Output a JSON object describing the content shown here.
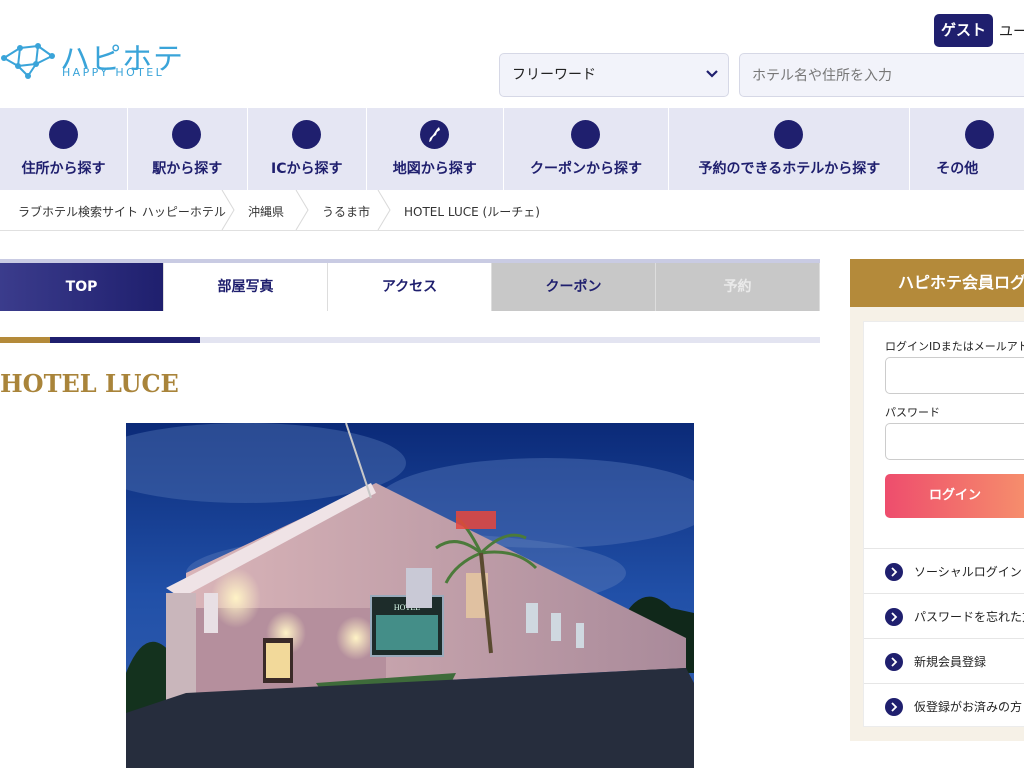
{
  "header": {
    "logo_jp": "ハピホテ",
    "logo_en": "HAPPY HOTEL",
    "guest_label": "ゲスト",
    "user_link": "ユー",
    "search_mode": "フリーワード",
    "search_placeholder": "ホテル名や住所を入力"
  },
  "nav": {
    "items": [
      {
        "label": "住所から探す",
        "icon": "area-icon"
      },
      {
        "label": "駅から探す",
        "icon": "station-icon"
      },
      {
        "label": "ICから探す",
        "icon": "highway-icon"
      },
      {
        "label": "地図から探す",
        "icon": "map-icon"
      },
      {
        "label": "クーポンから探す",
        "icon": "coupon-icon"
      },
      {
        "label": "予約のできるホテルから探す",
        "icon": "reserve-icon"
      },
      {
        "label": "その他",
        "icon": "more-icon"
      }
    ]
  },
  "breadcrumb": [
    "ラブホテル検索サイト ハッピーホテル",
    "沖縄県",
    "うるま市",
    "HOTEL LUCE (ルーチェ)"
  ],
  "tabs": [
    "TOP",
    "部屋写真",
    "アクセス",
    "クーポン",
    "予約"
  ],
  "hotel": {
    "name": "HOTEL LUCE",
    "sign_text": "HOTEL"
  },
  "login": {
    "title": "ハピホテ会員ログ",
    "id_label": "ログインIDまたはメールアドレ",
    "password_label": "パスワード",
    "login_button": "ログイン",
    "links": [
      "ソーシャルログイン",
      "パスワードを忘れた方",
      "新規会員登録",
      "仮登録がお済みの方"
    ]
  },
  "colors": {
    "navy": "#1f1f6e",
    "gold": "#b48a3a",
    "nav_bg": "#e5e6f3",
    "logo_blue": "#3aa4d9"
  }
}
